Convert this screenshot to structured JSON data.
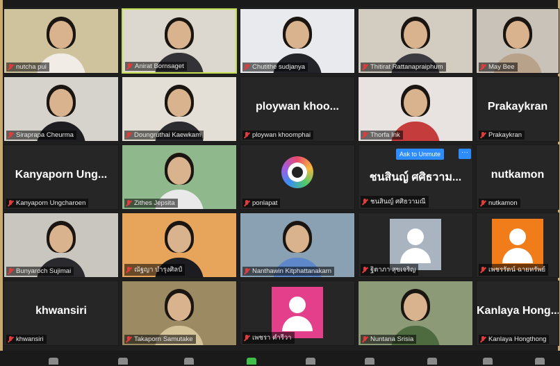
{
  "participants": [
    {
      "name": "nutcha pui",
      "type": "video",
      "bg": "#cfc39d",
      "shirt": "#f1ede6"
    },
    {
      "name": "Anirat Bornsaget",
      "type": "video",
      "bg": "#ddd8cf",
      "shirt": "#333236",
      "active": true
    },
    {
      "name": "Chutithe sudjanya",
      "type": "video",
      "bg": "#e9eaee",
      "shirt": "#23242a"
    },
    {
      "name": "Thitirat Rattanapraiphum",
      "type": "video",
      "bg": "#d3cdc1",
      "shirt": "#3b3a40"
    },
    {
      "name": "May Bee",
      "type": "video",
      "bg": "#c9c2b8",
      "shirt": "#b8a28a"
    },
    {
      "name": "Siraprapa Cheurma",
      "type": "video",
      "bg": "#d6d3cd",
      "shirt": "#1d1d22"
    },
    {
      "name": "Doungruthai Kaewkam",
      "type": "video",
      "bg": "#e4dfd6",
      "shirt": "#2b2b30"
    },
    {
      "name": "ploywan khoomphai",
      "type": "name",
      "display": "ploywan khoo..."
    },
    {
      "name": "Thorfa Ink",
      "type": "video",
      "bg": "#e8e3e0",
      "shirt": "#c43c3c"
    },
    {
      "name": "Prakaykran",
      "type": "name",
      "display": "Prakaykran"
    },
    {
      "name": "Kanyaporn Ungcharoen",
      "type": "name",
      "display": "Kanyaporn Ung..."
    },
    {
      "name": "Zithes Jepsita",
      "type": "video",
      "bg": "#8fb88d",
      "shirt": "#e9e9e9"
    },
    {
      "name": "ponlapat",
      "type": "icon"
    },
    {
      "name": "ชนสินญ์ ศศิธวามณี",
      "type": "name",
      "display": "ชนสินญ์ ศศิธวาม...",
      "ask_button": "Ask to Unmute",
      "more_button": "···"
    },
    {
      "name": "nutkamon",
      "type": "name",
      "display": "nutkamon"
    },
    {
      "name": "Bunyaroch Sujimai",
      "type": "video",
      "bg": "#c9c6bf",
      "shirt": "#2a2a2e"
    },
    {
      "name": "ณัฐญา บำรุงศิลป์",
      "type": "video",
      "bg": "#e7a55c",
      "shirt": "#1c1c20"
    },
    {
      "name": "Nanthawin Kitphattanakarn",
      "type": "video",
      "bg": "#8aa0b3",
      "shirt": "#5d87c9"
    },
    {
      "name": "ฐิตาภา สุขเจริญ",
      "type": "avatar",
      "color": "#a9b4c0"
    },
    {
      "name": "เพชรรัตน์ ฉายทรัพย์",
      "type": "avatar",
      "color": "#f07c1a"
    },
    {
      "name": "khwansiri",
      "type": "name",
      "display": "khwansiri"
    },
    {
      "name": "Takaporn Samutake",
      "type": "video",
      "bg": "#9c8a63",
      "shirt": "#d5c49a"
    },
    {
      "name": "เพชรา คำรีวา",
      "type": "avatar",
      "color": "#e43f8a"
    },
    {
      "name": "Nuntana Srisia",
      "type": "video",
      "bg": "#8c9a78",
      "shirt": "#4d6b3e"
    },
    {
      "name": "Kanlaya Hongthong",
      "type": "name",
      "display": "Kanlaya Hong..."
    }
  ]
}
